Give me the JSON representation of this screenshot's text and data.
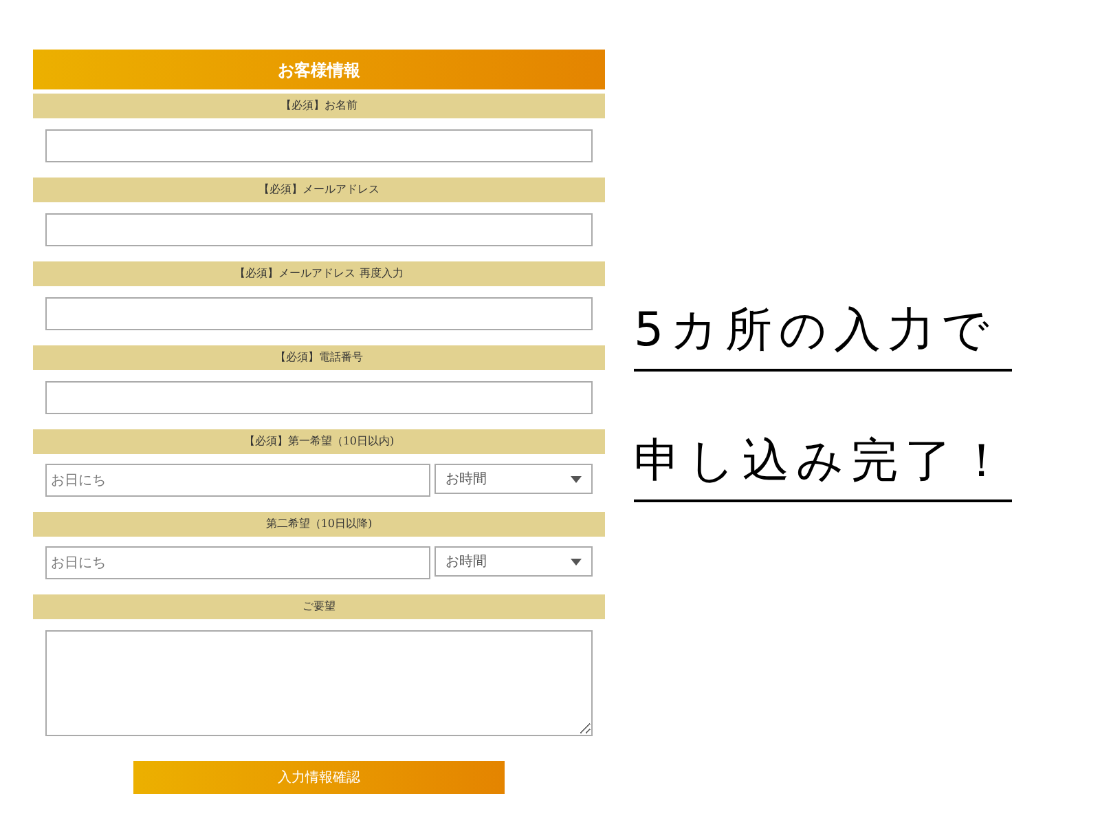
{
  "form": {
    "title": "お客様情報",
    "sections": [
      {
        "label": "【必須】お名前",
        "kind": "text"
      },
      {
        "label": "【必須】メールアドレス",
        "kind": "text"
      },
      {
        "label": "【必須】メールアドレス 再度入力",
        "kind": "text"
      },
      {
        "label": "【必須】電話番号",
        "kind": "text"
      },
      {
        "label": "【必須】第一希望（10日以内)",
        "kind": "datetime",
        "placeholder": "お日にち",
        "select": "お時間"
      },
      {
        "label": "第二希望（10日以降)",
        "kind": "datetime",
        "placeholder": "お日にち",
        "select": "お時間"
      },
      {
        "label": "ご要望",
        "kind": "textarea"
      }
    ],
    "submit": "入力情報確認"
  },
  "promo": [
    "5カ所の入力で",
    "申し込み完了！"
  ]
}
